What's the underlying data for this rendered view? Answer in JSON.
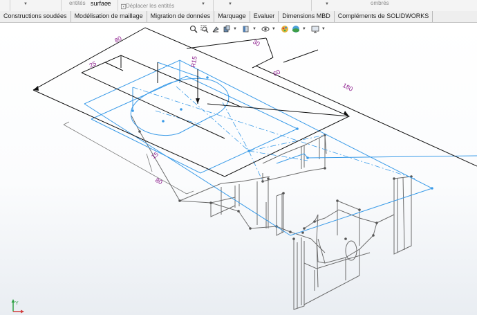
{
  "ribbon_top": {
    "items": [
      {
        "label": "",
        "caret": true
      },
      {
        "label": "entités",
        "caret": false
      },
      {
        "label": "surface",
        "active": true
      },
      {
        "label": "Déplacer les entités",
        "caret": true
      },
      {
        "label": "",
        "caret": true
      },
      {
        "label": "",
        "caret": true
      },
      {
        "label": "ombrés",
        "caret": false
      }
    ]
  },
  "tabs": [
    "Constructions soudées",
    "Modélisation de maillage",
    "Migration de données",
    "Marquage",
    "Evaluer",
    "Dimensions MBD",
    "Compléments de SOLIDWORKS"
  ],
  "heads_up_toolbar": {
    "icons": [
      "zoom-to-fit-icon",
      "zoom-area-icon",
      "previous-view-icon",
      "section-view-icon",
      "view-orientation-icon",
      "display-style-icon",
      "hide-show-items-icon",
      "edit-appearance-icon",
      "apply-scene-icon",
      "view-settings-icon"
    ]
  },
  "dimensions": {
    "d80_top": "80",
    "d25": "25",
    "d30": "30",
    "dR15": "R15",
    "d60": "60",
    "d180": "180",
    "d15": "15",
    "d80_bottom": "80"
  },
  "triad": {
    "y_label": "Y",
    "x_label": "X"
  },
  "colors": {
    "sketch_blue": "#3a9be8",
    "dimension_black": "#111111",
    "dimension_text": "#8b1a8b",
    "model_gray": "#6b6b6b"
  }
}
